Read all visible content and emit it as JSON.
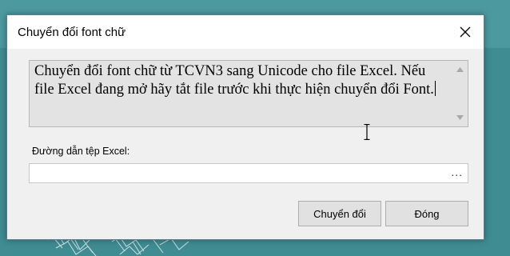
{
  "window": {
    "title": "Chuyển đổi font chữ"
  },
  "info": {
    "text": "Chuyển đổi font chữ từ TCVN3 sang Unicode cho file Excel. Nếu file Excel đang mở hãy tắt file trước khi thực hiện chuyển đổi Font."
  },
  "path_field": {
    "label": "Đường dẫn tệp Excel:",
    "value": "",
    "browse_label": "..."
  },
  "buttons": {
    "convert_label": "Chuyển đổi",
    "close_label": "Đóng"
  },
  "icons": {
    "close": "close-icon",
    "scroll_up": "arrow-up-icon",
    "scroll_down": "arrow-down-icon",
    "cursor": "ibeam-cursor-icon"
  },
  "colors": {
    "desktop": "#3f8c92",
    "dialog_bg": "#f0f0f0",
    "button_bg": "#e1e1e1"
  }
}
